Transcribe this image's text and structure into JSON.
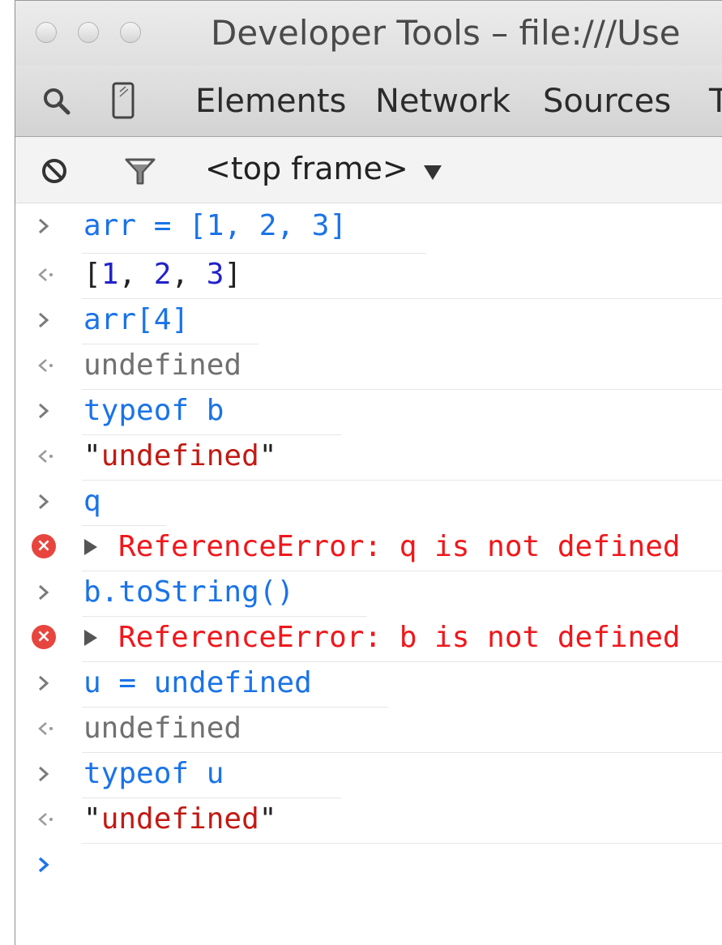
{
  "window": {
    "title": "Developer Tools – file:///Use"
  },
  "toolbar": {
    "tabs": [
      {
        "label": "Elements"
      },
      {
        "label": "Network"
      },
      {
        "label": "Sources"
      },
      {
        "label": "T"
      }
    ],
    "icons": [
      "search-icon",
      "device-mode-icon"
    ]
  },
  "console_toolbar": {
    "icons": [
      "clear-console-icon",
      "filter-icon"
    ],
    "frame_selector": "<top frame>"
  },
  "console": {
    "colors": {
      "input": "#1a73e8",
      "result_gray": "#707070",
      "string": "#c21a13",
      "error": "#f0171b",
      "number": "#2222cc",
      "error_badge": "#e7453e"
    },
    "rows": [
      {
        "kind": "input",
        "text": "arr = [1, 2, 3]"
      },
      {
        "kind": "result",
        "parts": [
          "[",
          "1",
          ", ",
          "2",
          ", ",
          "3",
          "]"
        ]
      },
      {
        "kind": "input",
        "text": "arr[4]"
      },
      {
        "kind": "result",
        "text": "undefined"
      },
      {
        "kind": "input",
        "text": "typeof b"
      },
      {
        "kind": "result",
        "parts": [
          "\"",
          "undefined",
          "\""
        ]
      },
      {
        "kind": "input",
        "text": "q"
      },
      {
        "kind": "error",
        "text": "ReferenceError: q is not defined"
      },
      {
        "kind": "input",
        "text": "b.toString()"
      },
      {
        "kind": "error",
        "text": "ReferenceError: b is not defined"
      },
      {
        "kind": "input",
        "text": "u = undefined"
      },
      {
        "kind": "result",
        "text": "undefined"
      },
      {
        "kind": "input",
        "text": "typeof u"
      },
      {
        "kind": "result",
        "parts": [
          "\"",
          "undefined",
          "\""
        ]
      },
      {
        "kind": "prompt",
        "text": ""
      }
    ],
    "error_badge_glyph": "×"
  }
}
